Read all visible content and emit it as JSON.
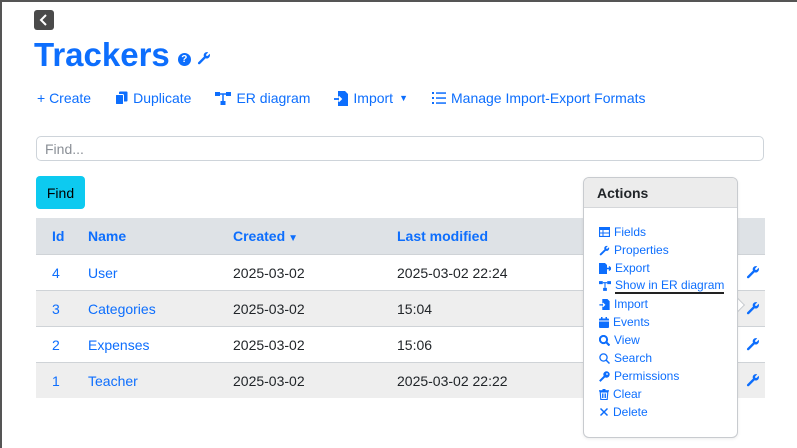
{
  "header": {
    "back_label": "<",
    "title": "Trackers",
    "help_label": "?"
  },
  "toolbar": {
    "create": "+ Create",
    "duplicate": "Duplicate",
    "er_diagram": "ER diagram",
    "import": "Import",
    "manage_formats": "Manage Import-Export Formats"
  },
  "search": {
    "placeholder": "Find...",
    "button": "Find"
  },
  "table": {
    "columns": {
      "id": "Id",
      "name": "Name",
      "created": "Created",
      "modified": "Last modified"
    },
    "rows": [
      {
        "id": "4",
        "name": "User",
        "created": "2025-03-02",
        "modified": "2025-03-02 22:24"
      },
      {
        "id": "3",
        "name": "Categories",
        "created": "2025-03-02",
        "modified": "15:04"
      },
      {
        "id": "2",
        "name": "Expenses",
        "created": "2025-03-02",
        "modified": "15:06"
      },
      {
        "id": "1",
        "name": "Teacher",
        "created": "2025-03-02",
        "modified": "2025-03-02 22:22"
      }
    ]
  },
  "actions": {
    "title": "Actions",
    "items": [
      {
        "label": "Fields",
        "icon": "table-icon"
      },
      {
        "label": "Properties",
        "icon": "wrench-icon"
      },
      {
        "label": "Export",
        "icon": "file-export-icon"
      },
      {
        "label": "Show in ER diagram",
        "icon": "diagram-icon"
      },
      {
        "label": "Import",
        "icon": "file-import-icon"
      },
      {
        "label": "Events",
        "icon": "calendar-icon"
      },
      {
        "label": "View",
        "icon": "magnify-icon"
      },
      {
        "label": "Search",
        "icon": "search-icon"
      },
      {
        "label": "Permissions",
        "icon": "key-icon"
      },
      {
        "label": "Clear",
        "icon": "trash-icon"
      },
      {
        "label": "Delete",
        "icon": "x-icon"
      }
    ]
  },
  "colors": {
    "primary": "#0d6efd",
    "find_button": "#0dcaf0",
    "header_row": "#dee2e6",
    "stripe": "#eeeeee"
  }
}
